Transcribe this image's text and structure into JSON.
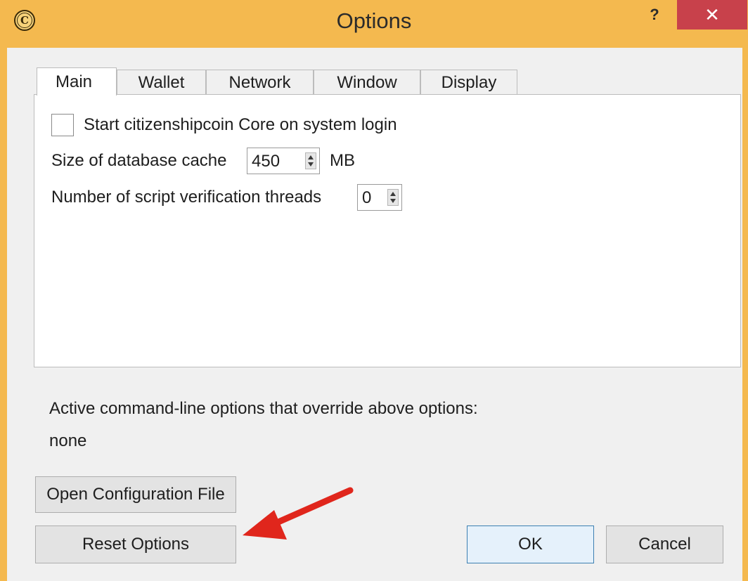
{
  "window": {
    "title": "Options",
    "icon": "citizenshipcoin-logo",
    "help_label": "?",
    "close_label": "✕",
    "accent_color": "#f4b94f",
    "close_color": "#c8414b"
  },
  "tabs": [
    {
      "label": "Main",
      "active": true
    },
    {
      "label": "Wallet",
      "active": false
    },
    {
      "label": "Network",
      "active": false
    },
    {
      "label": "Window",
      "active": false
    },
    {
      "label": "Display",
      "active": false
    }
  ],
  "main": {
    "start_on_login": {
      "label": "Start citizenshipcoin Core on system login",
      "checked": false
    },
    "db_cache": {
      "label": "Size of database cache",
      "value": "450",
      "unit": "MB"
    },
    "script_threads": {
      "label": "Number of script verification threads",
      "value": "0"
    }
  },
  "overrides": {
    "label": "Active command-line options that override above options:",
    "value": "none"
  },
  "buttons": {
    "open_config": "Open Configuration File",
    "reset": "Reset Options",
    "ok": "OK",
    "cancel": "Cancel"
  },
  "annotation": {
    "arrow_color": "#e0261c"
  }
}
